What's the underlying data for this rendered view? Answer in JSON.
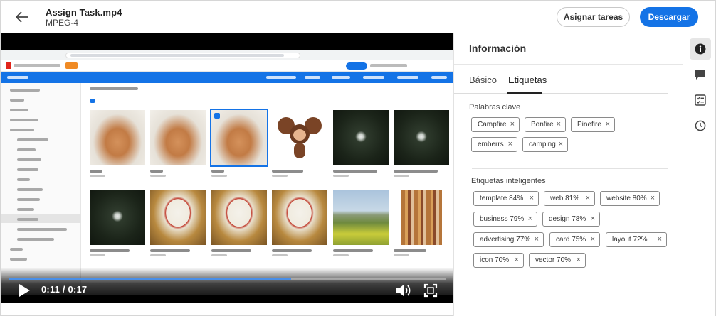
{
  "header": {
    "back_label": "←",
    "title": "Assign Task.mp4",
    "subtitle": "MPEG-4",
    "assign_button": "Asignar tareas",
    "download_button": "Descargar"
  },
  "player": {
    "time": "0:11 / 0:17",
    "progress": 0.647
  },
  "panel": {
    "title": "Información",
    "tabs": [
      {
        "label": "Básico",
        "active": false
      },
      {
        "label": "Etiquetas",
        "active": true
      }
    ],
    "keywords_title": "Palabras clave",
    "keywords": [
      "Campfire",
      "Bonfire",
      "Pinefire",
      "emberrs",
      "camping"
    ],
    "smart_tags_title": "Etiquetas inteligentes",
    "smart_tags": [
      "template 84%",
      "web 81%",
      "website 80%",
      "business 79%",
      "design 78%",
      "advertising 77%",
      "card 75%",
      "layout 72%",
      "icon 70%",
      "vector 70%"
    ],
    "remove_glyph": "×"
  },
  "rail": {
    "icons": [
      "info-icon",
      "comment-icon",
      "tasks-icon",
      "history-icon"
    ]
  },
  "colors": {
    "primary": "#1473e6",
    "progress": "#4a8fe8"
  }
}
